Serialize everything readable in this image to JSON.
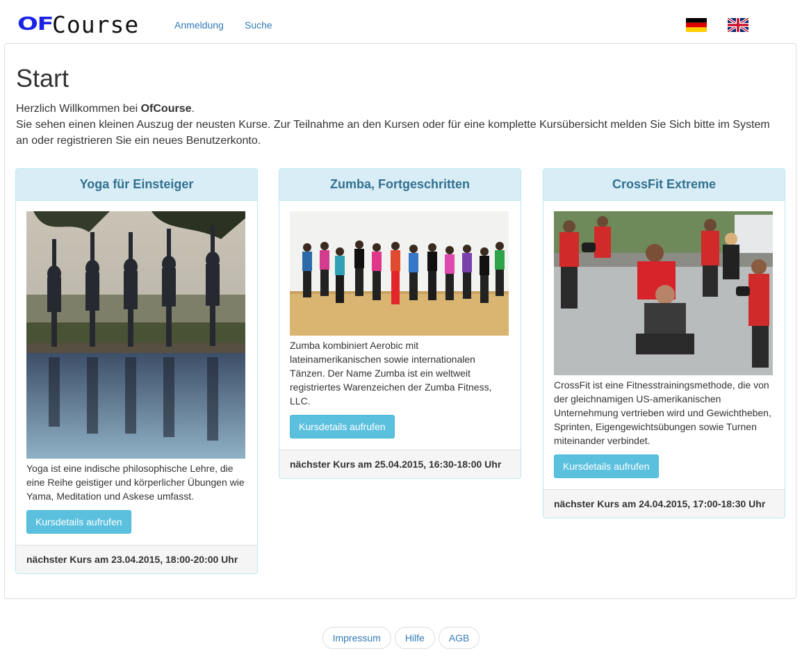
{
  "header": {
    "logo_prefix": "OF",
    "logo_suffix": "Course",
    "nav": [
      {
        "label": "Anmeldung"
      },
      {
        "label": "Suche"
      }
    ],
    "languages": [
      "german-flag-icon",
      "uk-flag-icon"
    ]
  },
  "main": {
    "title": "Start",
    "intro_greeting": "Herzlich Willkommen bei ",
    "intro_brand": "OfCourse",
    "intro_greeting_end": ".",
    "intro_text": "Sie sehen einen kleinen Auszug der neusten Kurse. Zur Teilnahme an den Kursen oder für eine komplette Kursübersicht melden Sie Sich bitte im System an oder registrieren Sie ein neues Benutzerkonto."
  },
  "courses": [
    {
      "title": "Yoga für Einsteiger",
      "image": "yoga-photo",
      "description": "Yoga ist eine indische philosophische Lehre, die eine Reihe geistiger und körperlicher Übungen wie Yama, Meditation und Askese umfasst.",
      "button": "Kursdetails aufrufen",
      "next": "nächster Kurs am 23.04.2015, 18:00-20:00 Uhr"
    },
    {
      "title": "Zumba, Fortgeschritten",
      "image": "zumba-photo",
      "description": "Zumba kombiniert Aerobic mit lateinamerikanischen sowie internationalen Tänzen. Der Name Zumba ist ein weltweit registriertes Warenzeichen der Zumba Fitness, LLC.",
      "button": "Kursdetails aufrufen",
      "next": "nächster Kurs am 25.04.2015, 16:30-18:00 Uhr"
    },
    {
      "title": "CrossFit Extreme",
      "image": "crossfit-photo",
      "description": "CrossFit ist eine Fitnesstrainingsmethode, die von der gleichnamigen US-amerikanischen Unternehmung vertrieben wird und Gewichtheben, Sprinten, Eigengewichtsübungen sowie Turnen miteinander verbindet.",
      "button": "Kursdetails aufrufen",
      "next": "nächster Kurs am 24.04.2015, 17:00-18:30 Uhr"
    }
  ],
  "footer": {
    "links": [
      {
        "label": "Impressum"
      },
      {
        "label": "Hilfe"
      },
      {
        "label": "AGB"
      }
    ]
  },
  "colors": {
    "accent": "#337ab7",
    "card_header_bg": "#d9edf7",
    "card_header_text": "#31708f",
    "button_info": "#5bc0de",
    "logo_blue": "#1a22e6"
  }
}
